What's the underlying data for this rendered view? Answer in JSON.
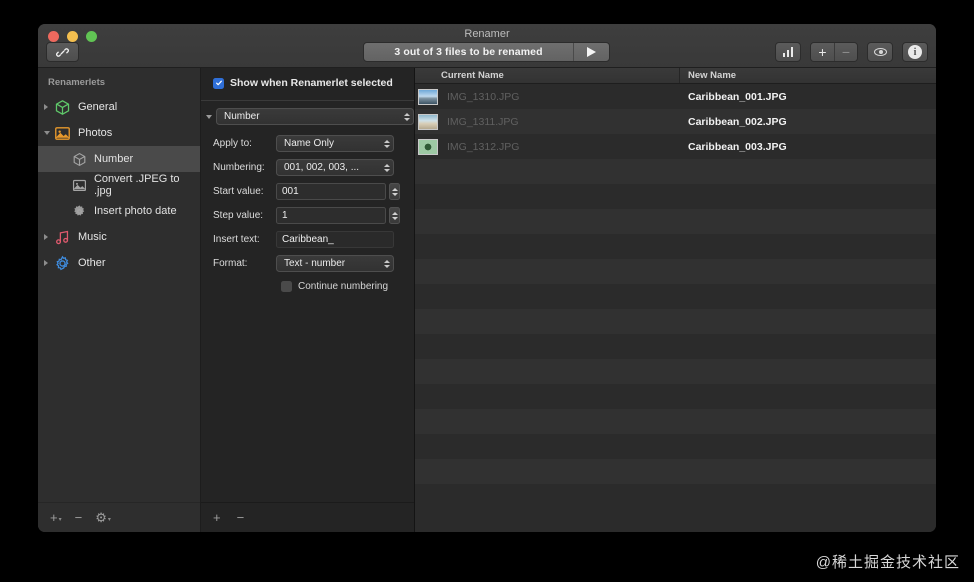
{
  "window": {
    "title": "Renamer",
    "traffic_lights": [
      "close",
      "minimize",
      "zoom"
    ],
    "chain_icon": "link-icon"
  },
  "toolbar": {
    "status_text": "3 out of 3 files to be renamed",
    "run_icon": "play-icon",
    "buttons": [
      {
        "name": "statistics-button",
        "icon": "bar-chart-icon"
      },
      {
        "name": "add-button",
        "icon": "plus-icon",
        "label": "+"
      },
      {
        "name": "remove-button",
        "icon": "minus-icon",
        "label": "−"
      },
      {
        "name": "preview-button",
        "icon": "eye-icon"
      },
      {
        "name": "info-button",
        "icon": "info-icon",
        "label": "i"
      }
    ]
  },
  "sidebar": {
    "header": "Renamerlets",
    "items": [
      {
        "label": "General",
        "icon": "cube-icon",
        "color": "#5fc86a",
        "level": 0,
        "expanded": false,
        "selected": false
      },
      {
        "label": "Photos",
        "icon": "photo-icon",
        "color": "#e8992c",
        "level": 0,
        "expanded": true,
        "selected": false
      },
      {
        "label": "Number",
        "icon": "cube-icon",
        "color": "#9a9a9a",
        "level": 1,
        "selected": true
      },
      {
        "label": "Convert .JPEG to .jpg",
        "icon": "photo-icon",
        "color": "#9a9a9a",
        "level": 1,
        "selected": false
      },
      {
        "label": "Insert photo date",
        "icon": "gear-icon",
        "color": "#9a9a9a",
        "level": 1,
        "selected": false
      },
      {
        "label": "Music",
        "icon": "music-note-icon",
        "color": "#e05a6e",
        "level": 0,
        "expanded": false,
        "selected": false
      },
      {
        "label": "Other",
        "icon": "gear-icon",
        "color": "#3f8de0",
        "level": 0,
        "expanded": false,
        "selected": false
      }
    ],
    "bottom_buttons": [
      {
        "name": "add-renamerlet-button",
        "label": "+",
        "caret": true
      },
      {
        "name": "remove-renamerlet-button",
        "label": "−",
        "caret": false
      },
      {
        "name": "renamerlet-actions-button",
        "label": "⚙",
        "caret": true
      }
    ]
  },
  "settings": {
    "show_when_selected_label": "Show when Renamerlet selected",
    "show_when_selected_checked": true,
    "module_name": "Number",
    "fields": [
      {
        "label": "Apply to:",
        "type": "popup",
        "value": "Name Only",
        "name": "apply-to-select"
      },
      {
        "label": "Numbering:",
        "type": "popup",
        "value": "001, 002, 003, ...",
        "name": "numbering-select"
      },
      {
        "label": "Start value:",
        "type": "stepper",
        "value": "001",
        "name": "start-value-field"
      },
      {
        "label": "Step value:",
        "type": "stepper",
        "value": "1",
        "name": "step-value-field"
      },
      {
        "label": "Insert text:",
        "type": "text",
        "value": "Caribbean_",
        "name": "insert-text-field"
      },
      {
        "label": "Format:",
        "type": "popup",
        "value": "Text - number",
        "name": "format-select"
      }
    ],
    "continue_numbering_label": "Continue numbering",
    "continue_numbering_checked": false,
    "bottom_buttons": [
      {
        "name": "add-action-button",
        "label": "+"
      },
      {
        "name": "remove-action-button",
        "label": "−"
      }
    ]
  },
  "filelist": {
    "columns": [
      "Current Name",
      "New Name"
    ],
    "rows": [
      {
        "current": "IMG_1310.JPG",
        "new": "Caribbean_001.JPG",
        "thumb": "beach-sunset-thumb"
      },
      {
        "current": "IMG_1311.JPG",
        "new": "Caribbean_002.JPG",
        "thumb": "beach-palm-thumb"
      },
      {
        "current": "IMG_1312.JPG",
        "new": "Caribbean_003.JPG",
        "thumb": "starfish-thumb"
      }
    ],
    "empty_row_count": 14
  },
  "watermark": {
    "text": "@稀土掘金技术社区"
  },
  "colors": {
    "accent": "#2f6fd8",
    "window_bg": "#2a2a2a",
    "sidebar_bg": "#2e2e2e",
    "settings_bg": "#242424",
    "list_bg": "#2b2b2b",
    "selected_row": "#4a4a4a"
  }
}
